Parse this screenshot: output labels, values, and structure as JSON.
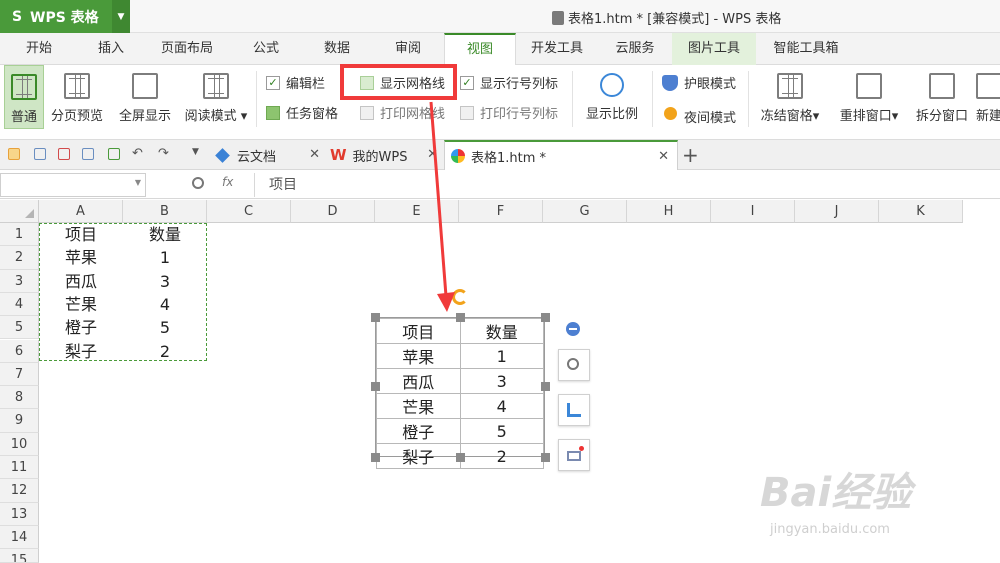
{
  "app": {
    "name": "WPS 表格",
    "window_title": "表格1.htm * [兼容模式] - WPS 表格"
  },
  "menu_tabs": [
    "开始",
    "插入",
    "页面布局",
    "公式",
    "数据",
    "审阅",
    "视图",
    "开发工具",
    "云服务",
    "图片工具",
    "智能工具箱"
  ],
  "active_menu": "视图",
  "ribbon": {
    "normal": "普通",
    "page_preview": "分页预览",
    "fullscreen": "全屏显示",
    "reading_mode": "阅读模式",
    "edit_bar": "编辑栏",
    "task_pane": "任务窗格",
    "show_gridlines": "显示网格线",
    "print_gridlines": "打印网格线",
    "show_row_col_headers": "显示行号列标",
    "print_row_col_headers": "打印行号列标",
    "zoom": "显示比例",
    "eye_protect": "护眼模式",
    "night_mode": "夜间模式",
    "freeze": "冻结窗格",
    "rearrange": "重排窗口",
    "split": "拆分窗口",
    "new": "新建"
  },
  "doc_tabs": [
    "云文档",
    "我的WPS",
    "表格1.htm *"
  ],
  "formula_bar": {
    "fx": "fx",
    "content": "项目"
  },
  "columns": [
    "A",
    "B",
    "C",
    "D",
    "E",
    "F",
    "G",
    "H",
    "I",
    "J",
    "K"
  ],
  "rows": [
    "1",
    "2",
    "3",
    "4",
    "5",
    "6",
    "7",
    "8",
    "9",
    "10",
    "11",
    "12",
    "13",
    "14",
    "15"
  ],
  "sheet_data": {
    "header": [
      "项目",
      "数量"
    ],
    "items": [
      [
        "苹果",
        "1"
      ],
      [
        "西瓜",
        "3"
      ],
      [
        "芒果",
        "4"
      ],
      [
        "橙子",
        "5"
      ],
      [
        "梨子",
        "2"
      ]
    ]
  },
  "picture_data": {
    "header": [
      "项目",
      "数量"
    ],
    "items": [
      [
        "苹果",
        "1"
      ],
      [
        "西瓜",
        "3"
      ],
      [
        "芒果",
        "4"
      ],
      [
        "橙子",
        "5"
      ],
      [
        "梨子",
        "2"
      ]
    ]
  },
  "watermark": {
    "brand": "Bai经验",
    "url": "jingyan.baidu.com"
  },
  "colors": {
    "accent": "#4a9a3a",
    "highlight_box": "#f03a3a",
    "arrow": "#f03a3a"
  }
}
